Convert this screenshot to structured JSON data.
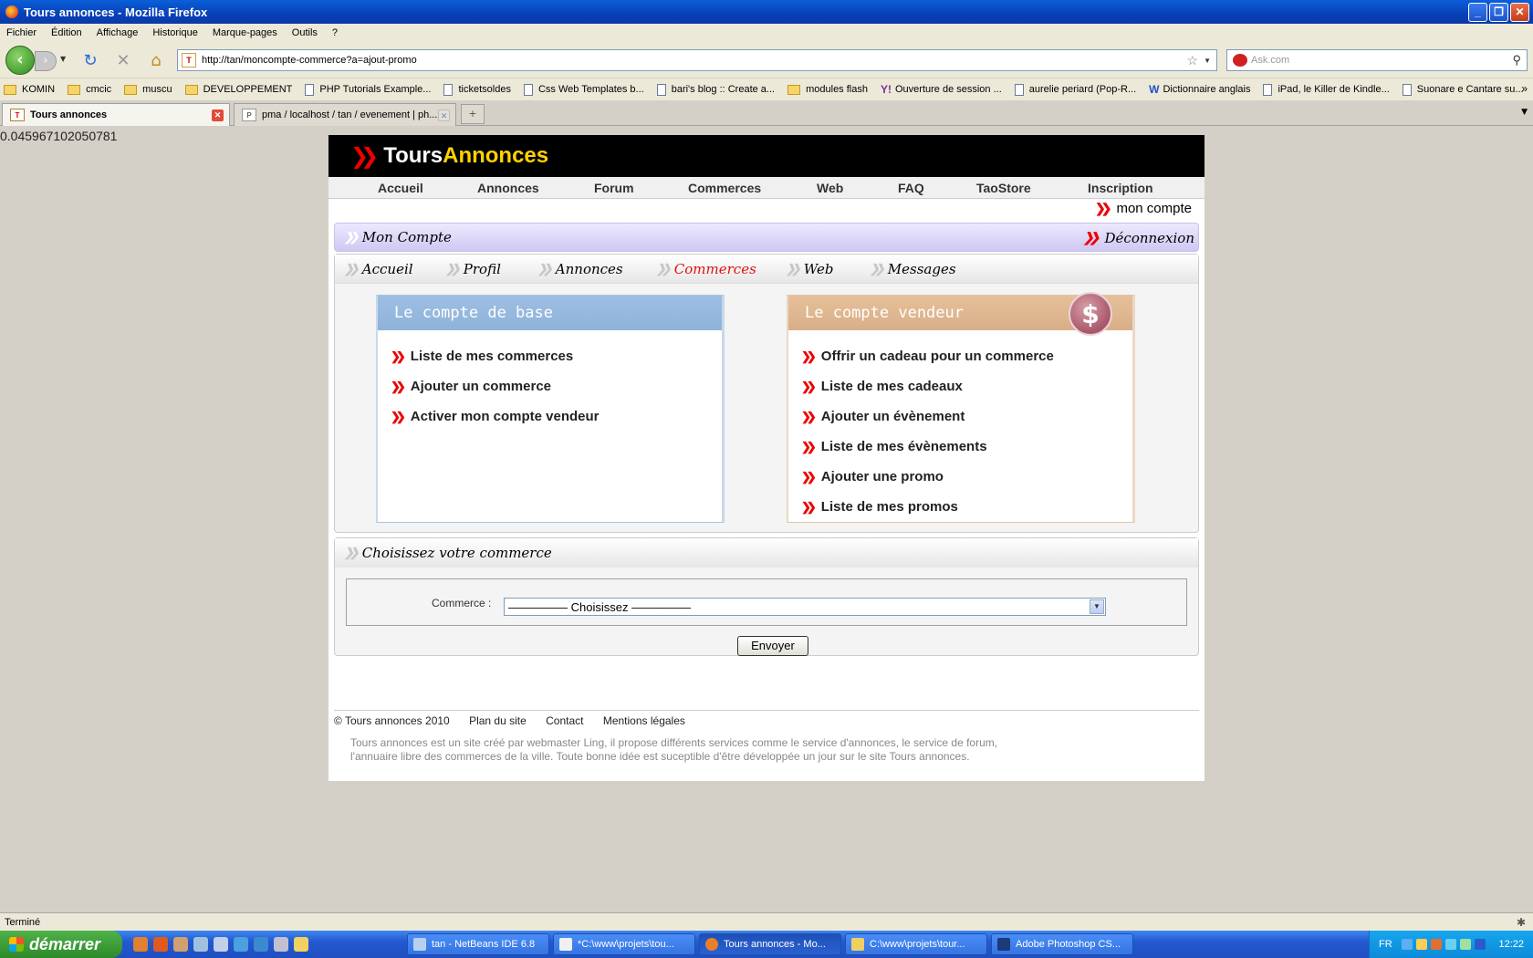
{
  "window": {
    "title": "Tours annonces - Mozilla Firefox"
  },
  "menu": [
    "Fichier",
    "Édition",
    "Affichage",
    "Historique",
    "Marque-pages",
    "Outils",
    "?"
  ],
  "address": {
    "url": "http://tan/moncompte-commerce?a=ajout-promo"
  },
  "search": {
    "placeholder": "Ask.com"
  },
  "bookmarks": [
    {
      "label": "KOMIN",
      "kind": "folder"
    },
    {
      "label": "cmcic",
      "kind": "folder"
    },
    {
      "label": "muscu",
      "kind": "folder"
    },
    {
      "label": "DEVELOPPEMENT",
      "kind": "folder"
    },
    {
      "label": "PHP Tutorials Example...",
      "kind": "page"
    },
    {
      "label": "ticketsoldes",
      "kind": "page"
    },
    {
      "label": "Css Web Templates b...",
      "kind": "page"
    },
    {
      "label": "bari's blog :: Create a...",
      "kind": "page"
    },
    {
      "label": "modules flash",
      "kind": "folder"
    },
    {
      "label": "Ouverture de session ...",
      "kind": "yahoo"
    },
    {
      "label": "aurelie periard (Pop-R...",
      "kind": "page"
    },
    {
      "label": "Dictionnaire anglais",
      "kind": "wr"
    },
    {
      "label": "iPad, le Killer de Kindle...",
      "kind": "page"
    },
    {
      "label": "Suonare e Cantare su...",
      "kind": "page"
    }
  ],
  "tabs": [
    {
      "label": "Tours annonces",
      "favicon": "TA"
    },
    {
      "label": "pma / localhost / tan / evenement | ph...",
      "favicon": "PMA"
    }
  ],
  "debug_number": "0.045967102050781",
  "site": {
    "logo_part1": "Tours",
    "logo_part2": "Annonces",
    "nav": [
      "Accueil",
      "Annonces",
      "Forum",
      "Commerces",
      "Web",
      "FAQ",
      "TaoStore",
      "Inscription"
    ],
    "mon_compte_link": "mon compte",
    "header_title": "Mon Compte",
    "logout": "Déconnexion",
    "subnav": [
      {
        "label": "Accueil",
        "active": false
      },
      {
        "label": "Profil",
        "active": false
      },
      {
        "label": "Annonces",
        "active": false
      },
      {
        "label": "Commerces",
        "active": true
      },
      {
        "label": "Web",
        "active": false
      },
      {
        "label": "Messages",
        "active": false
      }
    ],
    "base_box": {
      "title": "Le compte de base",
      "items": [
        "Liste de mes commerces",
        "Ajouter un commerce",
        "Activer mon compte vendeur"
      ]
    },
    "vendor_box": {
      "title": "Le compte vendeur",
      "badge": "$",
      "items": [
        "Offrir un cadeau pour un commerce",
        "Liste de mes cadeaux",
        "Ajouter un évènement",
        "Liste de mes évènements",
        "Ajouter une promo",
        "Liste de mes promos"
      ]
    },
    "choose": {
      "title": "Choisissez votre commerce",
      "field_label": "Commerce :",
      "select_value": "————— Choisissez —————",
      "submit": "Envoyer"
    },
    "footer": {
      "copyright": "© Tours annonces 2010",
      "links": [
        "Plan du site",
        "Contact",
        "Mentions légales"
      ],
      "description": "Tours annonces est un site créé par webmaster Ling, il propose différents services comme le service d'annonces, le service de forum, l'annuaire libre des commerces de la ville. Toute bonne idée est suceptible d'être développée un jour sur le site Tours annonces."
    }
  },
  "status": {
    "text": "Terminé"
  },
  "taskbar": {
    "start": "démarrer",
    "tasks": [
      {
        "label": "tan - NetBeans IDE 6.8",
        "active": false
      },
      {
        "label": "*C:\\www\\projets\\tou...",
        "active": false
      },
      {
        "label": "Tours annonces - Mo...",
        "active": true
      },
      {
        "label": "C:\\www\\projets\\tour...",
        "active": false
      },
      {
        "label": "Adobe Photoshop CS...",
        "active": false
      }
    ],
    "lang": "FR",
    "clock": "12:22"
  }
}
